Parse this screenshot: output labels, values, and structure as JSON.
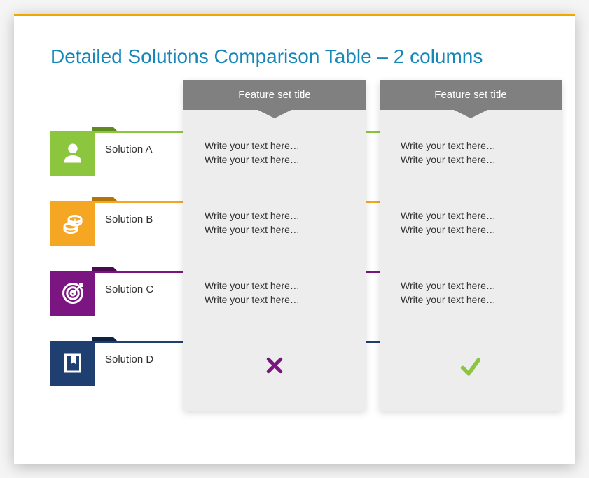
{
  "title": "Detailed Solutions Comparison Table – 2 columns",
  "columns": [
    {
      "header": "Feature set title"
    },
    {
      "header": "Feature set title"
    }
  ],
  "solutions": [
    {
      "label": "Solution A",
      "icon": "person-icon",
      "color": "#8cc63f",
      "cells": [
        {
          "line1": "Write your text here…",
          "line2": "Write your text here…"
        },
        {
          "line1": "Write your text here…",
          "line2": "Write your text here…"
        }
      ]
    },
    {
      "label": "Solution B",
      "icon": "coins-icon",
      "color": "#f5a623",
      "cells": [
        {
          "line1": "Write your text here…",
          "line2": "Write your text here…"
        },
        {
          "line1": "Write your text here…",
          "line2": "Write your text here…"
        }
      ]
    },
    {
      "label": "Solution C",
      "icon": "target-icon",
      "color": "#7b1581",
      "cells": [
        {
          "line1": "Write your text here…",
          "line2": "Write your text here…"
        },
        {
          "line1": "Write your text here…",
          "line2": "Write your text here…"
        }
      ]
    },
    {
      "label": "Solution D",
      "icon": "bookmark-icon",
      "color": "#1f3f70",
      "cells": [
        {
          "mark": "cross",
          "mark_color": "#7b1581"
        },
        {
          "mark": "check",
          "mark_color": "#8cc63f"
        }
      ]
    }
  ]
}
